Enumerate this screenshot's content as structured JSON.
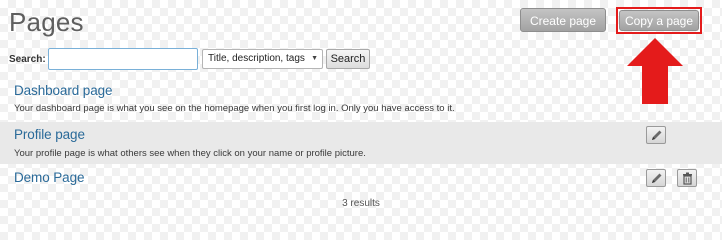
{
  "header": {
    "title": "Pages",
    "create_label": "Create page",
    "copy_label": "Copy a page"
  },
  "search": {
    "label": "Search:",
    "value": "",
    "placeholder": "",
    "scope_selected": "Title, description, tags",
    "button_label": "Search"
  },
  "pages": [
    {
      "name": "Dashboard page",
      "description": "Your dashboard page is what you see on the homepage when you first log in. Only you have access to it."
    },
    {
      "name": "Profile page",
      "description": "Your profile page is what others see when they click on your name or profile picture."
    },
    {
      "name": "Demo Page",
      "description": ""
    }
  ],
  "results_text": "3 results",
  "icons": {
    "edit": "pencil-icon",
    "delete": "trash-icon",
    "annotation": "up-arrow-icon",
    "dropdown": "chevron-down-icon"
  },
  "colors": {
    "highlight": "#e41b1b",
    "link": "#2a6a99",
    "button_gray": "#a9a9a9"
  }
}
